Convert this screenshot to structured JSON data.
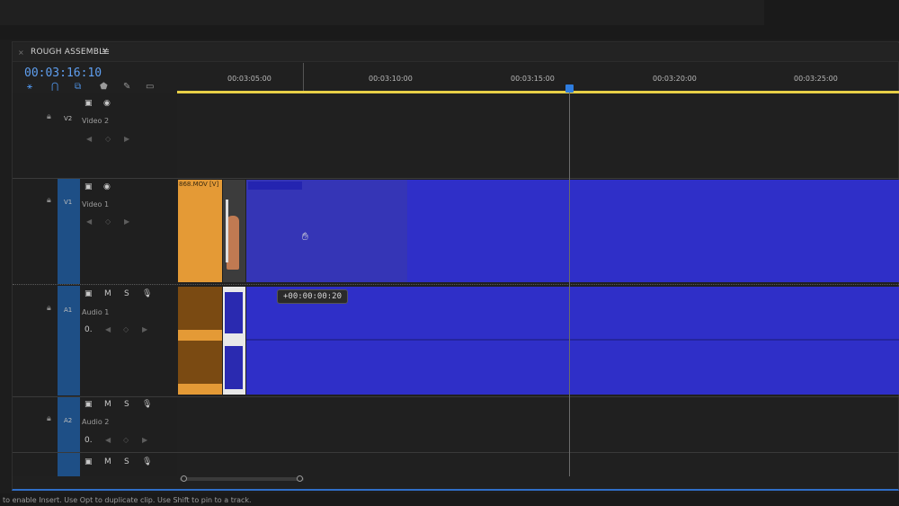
{
  "sequence": {
    "title": "ROUGH ASSEMBLY",
    "timecode": "00:03:16:10"
  },
  "ruler": {
    "ticks": [
      "00:03:05:00",
      "00:03:10:00",
      "00:03:15:00",
      "00:03:20:00",
      "00:03:25:00"
    ]
  },
  "tracks": {
    "v2": {
      "id": "V2",
      "name": "Video 2"
    },
    "v1": {
      "id": "V1",
      "name": "Video 1"
    },
    "a1": {
      "id": "A1",
      "name": "Audio 1"
    },
    "a2": {
      "id": "A2",
      "name": "Audio 2"
    }
  },
  "controls": {
    "mute": "M",
    "solo": "S",
    "volume_value": "0."
  },
  "clips": {
    "video_clip_label": "868.MOV [V]"
  },
  "drag_tooltip": "+00:00:00:20",
  "status_bar": "to enable Insert. Use Opt to duplicate clip. Use Shift to pin to a track.",
  "colors": {
    "accent_blue": "#2f6ec7",
    "playhead": "#2e7de0",
    "clip_orange": "#e49a36",
    "clip_blue": "#2f2fc8",
    "ruler_yellow": "#e7cf47"
  }
}
